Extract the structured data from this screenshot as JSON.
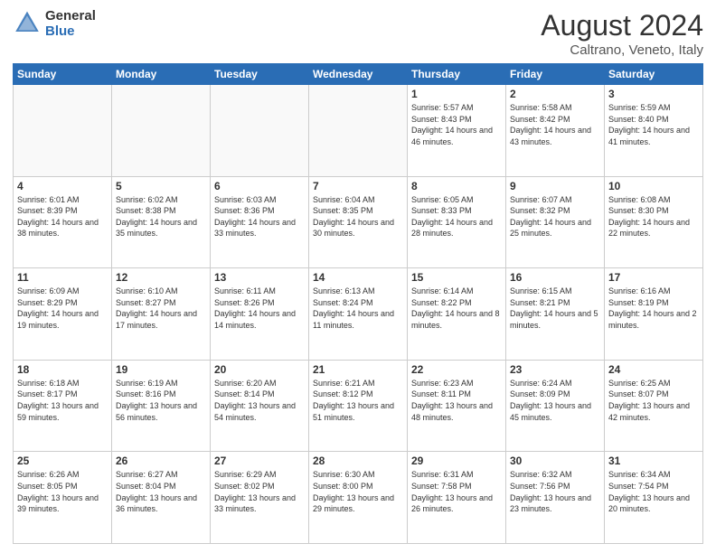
{
  "logo": {
    "general": "General",
    "blue": "Blue"
  },
  "title": "August 2024",
  "location": "Caltrano, Veneto, Italy",
  "weekdays": [
    "Sunday",
    "Monday",
    "Tuesday",
    "Wednesday",
    "Thursday",
    "Friday",
    "Saturday"
  ],
  "weeks": [
    [
      {
        "day": "",
        "info": ""
      },
      {
        "day": "",
        "info": ""
      },
      {
        "day": "",
        "info": ""
      },
      {
        "day": "",
        "info": ""
      },
      {
        "day": "1",
        "info": "Sunrise: 5:57 AM\nSunset: 8:43 PM\nDaylight: 14 hours\nand 46 minutes."
      },
      {
        "day": "2",
        "info": "Sunrise: 5:58 AM\nSunset: 8:42 PM\nDaylight: 14 hours\nand 43 minutes."
      },
      {
        "day": "3",
        "info": "Sunrise: 5:59 AM\nSunset: 8:40 PM\nDaylight: 14 hours\nand 41 minutes."
      }
    ],
    [
      {
        "day": "4",
        "info": "Sunrise: 6:01 AM\nSunset: 8:39 PM\nDaylight: 14 hours\nand 38 minutes."
      },
      {
        "day": "5",
        "info": "Sunrise: 6:02 AM\nSunset: 8:38 PM\nDaylight: 14 hours\nand 35 minutes."
      },
      {
        "day": "6",
        "info": "Sunrise: 6:03 AM\nSunset: 8:36 PM\nDaylight: 14 hours\nand 33 minutes."
      },
      {
        "day": "7",
        "info": "Sunrise: 6:04 AM\nSunset: 8:35 PM\nDaylight: 14 hours\nand 30 minutes."
      },
      {
        "day": "8",
        "info": "Sunrise: 6:05 AM\nSunset: 8:33 PM\nDaylight: 14 hours\nand 28 minutes."
      },
      {
        "day": "9",
        "info": "Sunrise: 6:07 AM\nSunset: 8:32 PM\nDaylight: 14 hours\nand 25 minutes."
      },
      {
        "day": "10",
        "info": "Sunrise: 6:08 AM\nSunset: 8:30 PM\nDaylight: 14 hours\nand 22 minutes."
      }
    ],
    [
      {
        "day": "11",
        "info": "Sunrise: 6:09 AM\nSunset: 8:29 PM\nDaylight: 14 hours\nand 19 minutes."
      },
      {
        "day": "12",
        "info": "Sunrise: 6:10 AM\nSunset: 8:27 PM\nDaylight: 14 hours\nand 17 minutes."
      },
      {
        "day": "13",
        "info": "Sunrise: 6:11 AM\nSunset: 8:26 PM\nDaylight: 14 hours\nand 14 minutes."
      },
      {
        "day": "14",
        "info": "Sunrise: 6:13 AM\nSunset: 8:24 PM\nDaylight: 14 hours\nand 11 minutes."
      },
      {
        "day": "15",
        "info": "Sunrise: 6:14 AM\nSunset: 8:22 PM\nDaylight: 14 hours\nand 8 minutes."
      },
      {
        "day": "16",
        "info": "Sunrise: 6:15 AM\nSunset: 8:21 PM\nDaylight: 14 hours\nand 5 minutes."
      },
      {
        "day": "17",
        "info": "Sunrise: 6:16 AM\nSunset: 8:19 PM\nDaylight: 14 hours\nand 2 minutes."
      }
    ],
    [
      {
        "day": "18",
        "info": "Sunrise: 6:18 AM\nSunset: 8:17 PM\nDaylight: 13 hours\nand 59 minutes."
      },
      {
        "day": "19",
        "info": "Sunrise: 6:19 AM\nSunset: 8:16 PM\nDaylight: 13 hours\nand 56 minutes."
      },
      {
        "day": "20",
        "info": "Sunrise: 6:20 AM\nSunset: 8:14 PM\nDaylight: 13 hours\nand 54 minutes."
      },
      {
        "day": "21",
        "info": "Sunrise: 6:21 AM\nSunset: 8:12 PM\nDaylight: 13 hours\nand 51 minutes."
      },
      {
        "day": "22",
        "info": "Sunrise: 6:23 AM\nSunset: 8:11 PM\nDaylight: 13 hours\nand 48 minutes."
      },
      {
        "day": "23",
        "info": "Sunrise: 6:24 AM\nSunset: 8:09 PM\nDaylight: 13 hours\nand 45 minutes."
      },
      {
        "day": "24",
        "info": "Sunrise: 6:25 AM\nSunset: 8:07 PM\nDaylight: 13 hours\nand 42 minutes."
      }
    ],
    [
      {
        "day": "25",
        "info": "Sunrise: 6:26 AM\nSunset: 8:05 PM\nDaylight: 13 hours\nand 39 minutes."
      },
      {
        "day": "26",
        "info": "Sunrise: 6:27 AM\nSunset: 8:04 PM\nDaylight: 13 hours\nand 36 minutes."
      },
      {
        "day": "27",
        "info": "Sunrise: 6:29 AM\nSunset: 8:02 PM\nDaylight: 13 hours\nand 33 minutes."
      },
      {
        "day": "28",
        "info": "Sunrise: 6:30 AM\nSunset: 8:00 PM\nDaylight: 13 hours\nand 29 minutes."
      },
      {
        "day": "29",
        "info": "Sunrise: 6:31 AM\nSunset: 7:58 PM\nDaylight: 13 hours\nand 26 minutes."
      },
      {
        "day": "30",
        "info": "Sunrise: 6:32 AM\nSunset: 7:56 PM\nDaylight: 13 hours\nand 23 minutes."
      },
      {
        "day": "31",
        "info": "Sunrise: 6:34 AM\nSunset: 7:54 PM\nDaylight: 13 hours\nand 20 minutes."
      }
    ]
  ]
}
